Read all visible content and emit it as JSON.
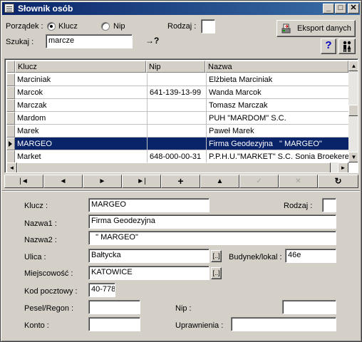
{
  "window": {
    "title": "Słownik osób",
    "min": "_",
    "max": "□",
    "close": "✕"
  },
  "toolbar": {
    "order_label": "Porządek :",
    "radio_klucz": "Klucz",
    "radio_nip": "Nip",
    "rodzaj_label": "Rodzaj :",
    "rodzaj_value": "",
    "search_label": "Szukaj :",
    "search_value": "marcze",
    "goto_glyph": "→?",
    "export_label": "Eksport danych",
    "help_glyph": "?",
    "people_glyph": "👥"
  },
  "grid": {
    "headers": [
      "Klucz",
      "Nip",
      "Nazwa"
    ],
    "rows": [
      {
        "klucz": "Marciniak",
        "nip": "",
        "nazwa": "Elżbieta Marciniak"
      },
      {
        "klucz": "Marcok",
        "nip": "641-139-13-99",
        "nazwa": "Wanda Marcok"
      },
      {
        "klucz": "Marczak",
        "nip": "",
        "nazwa": "Tomasz Marczak"
      },
      {
        "klucz": "Mardom",
        "nip": "",
        "nazwa": "PUH \"MARDOM\" S.C."
      },
      {
        "klucz": "Marek",
        "nip": "",
        "nazwa": "Paweł Marek"
      },
      {
        "klucz": "MARGEO",
        "nip": "",
        "nazwa": "Firma Geodezyjna   \" MARGEO\""
      },
      {
        "klucz": "Market",
        "nip": "648-000-00-31",
        "nazwa": "P.P.H.U.\"MARKET\" S.C. Sonia Broekere"
      }
    ],
    "selected_index": 5
  },
  "navigator": {
    "first": "|◄",
    "prior": "◄",
    "next": "►",
    "last": "►|",
    "insert": "+",
    "delete": "▲",
    "post": "✓",
    "cancel": "✕",
    "refresh": "↻"
  },
  "form": {
    "klucz_label": "Klucz :",
    "klucz_value": "MARGEO",
    "rodzaj_label": "Rodzaj :",
    "rodzaj_value": "",
    "nazwa1_label": "Nazwa1 :",
    "nazwa1_value": "Firma Geodezyjna",
    "nazwa2_label": "Nazwa2 :",
    "nazwa2_value": "  \" MARGEO\"",
    "ulica_label": "Ulica :",
    "ulica_value": "Bałtycka",
    "budynek_label": "Budynek/lokal :",
    "budynek_value": "46e",
    "miejscowosc_label": "Miejscowość :",
    "miejscowosc_value": "KATOWICE",
    "kod_label": "Kod pocztowy :",
    "kod_value": "40-778",
    "pesel_label": "Pesel/Regon :",
    "pesel_value": "",
    "nip_label": "Nip :",
    "nip_value": "",
    "konto_label": "Konto :",
    "konto_value": "",
    "uprawnienia_label": "Uprawnienia :",
    "uprawnienia_value": "",
    "lookup_glyph": "[..]"
  }
}
